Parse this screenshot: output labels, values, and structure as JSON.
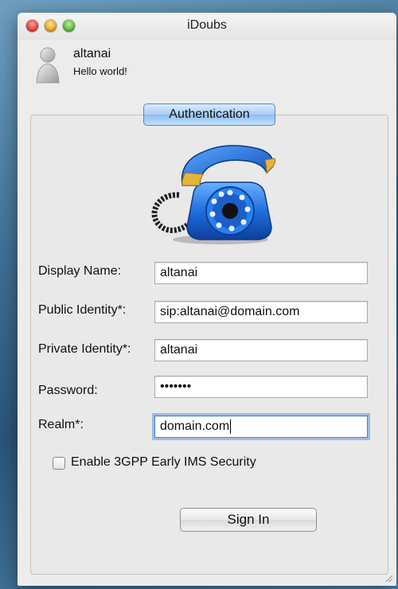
{
  "window": {
    "title": "iDoubs"
  },
  "user": {
    "name": "altanai",
    "status": "Hello world!"
  },
  "tab": {
    "label": "Authentication"
  },
  "form": {
    "display_name": {
      "label": "Display Name:",
      "value": "altanai"
    },
    "public_identity": {
      "label": "Public Identity*:",
      "value": "sip:altanai@domain.com"
    },
    "private_identity": {
      "label": "Private Identity*:",
      "value": "altanai"
    },
    "password": {
      "label": "Password:",
      "value": "•••••••"
    },
    "realm": {
      "label": "Realm*:",
      "value": "domain.com"
    },
    "early_ims": {
      "label": "Enable 3GPP Early IMS Security",
      "checked": false
    }
  },
  "actions": {
    "sign_in": "Sign In"
  },
  "icons": {
    "avatar": "user-silhouette-icon",
    "phone": "telephone-icon",
    "resize": "resize-grip-icon"
  },
  "colors": {
    "tab_blue": "#a9cdf4",
    "phone_blue": "#1f6fe0",
    "phone_accent": "#e5b43a"
  }
}
